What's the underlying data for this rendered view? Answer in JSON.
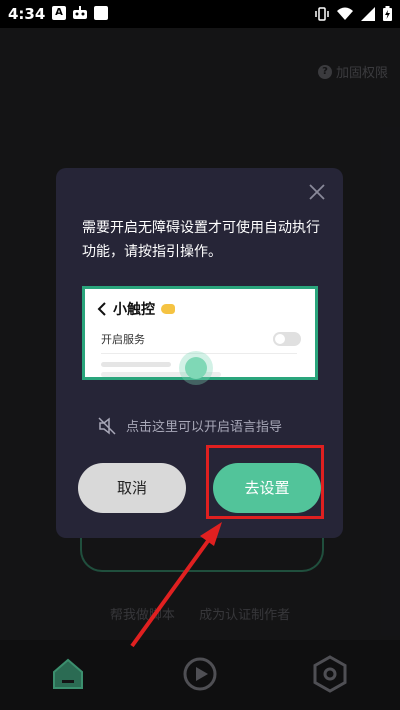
{
  "status_bar": {
    "time": "4:34",
    "left_icons": [
      "a-icon",
      "robot-icon",
      "square-icon"
    ],
    "right_icons": [
      "vibrate-icon",
      "wifi-icon",
      "signal-icon",
      "battery-icon"
    ]
  },
  "background": {
    "help_link": "加固权限",
    "links": [
      "帮我做脚本",
      "成为认证制作者"
    ]
  },
  "bottom_nav": {
    "items": [
      "home-icon",
      "play-icon",
      "settings-hex-icon"
    ]
  },
  "dialog": {
    "message": "需要开启无障碍设置才可使用自动执行功能，请按指引操作。",
    "guide": {
      "title": "小触控",
      "row_label": "开启服务"
    },
    "voice_hint": "点击这里可以开启语言指导",
    "cancel_label": "取消",
    "settings_label": "去设置"
  },
  "colors": {
    "accent": "#52c49a",
    "highlight": "#e02020",
    "dialog_bg": "#262537"
  }
}
